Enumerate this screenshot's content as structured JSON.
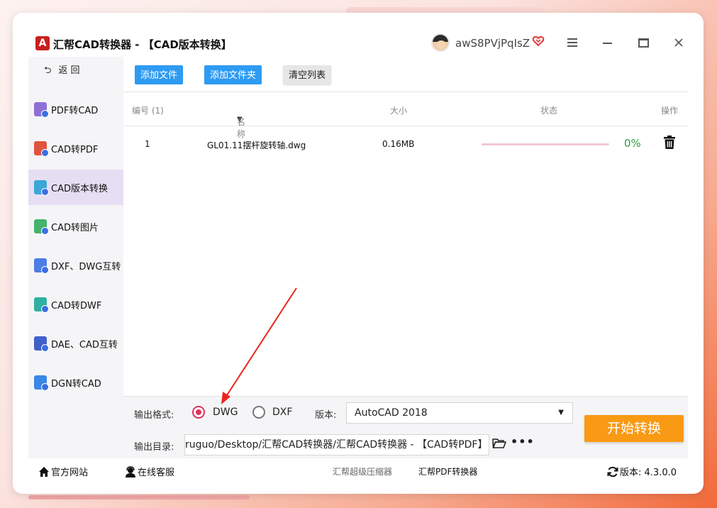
{
  "window": {
    "title": "汇帮CAD转换器 - 【CAD版本转换】",
    "logo_letter": "A",
    "username": "awS8PVjPqIsZ",
    "icons": [
      "vip-heart-icon",
      "menu-icon",
      "minimize-icon",
      "maximize-icon",
      "close-icon"
    ]
  },
  "sidebar": {
    "back_label": "返 回",
    "items": [
      {
        "label": "PDF转CAD",
        "icon": "pdf-to-cad-icon",
        "active": false
      },
      {
        "label": "CAD转PDF",
        "icon": "cad-to-pdf-icon",
        "active": false
      },
      {
        "label": "CAD版本转换",
        "icon": "cad-version-icon",
        "active": true
      },
      {
        "label": "CAD转图片",
        "icon": "cad-to-image-icon",
        "active": false
      },
      {
        "label": "DXF、DWG互转",
        "icon": "dxf-dwg-icon",
        "active": false
      },
      {
        "label": "CAD转DWF",
        "icon": "cad-to-dwf-icon",
        "active": false
      },
      {
        "label": "DAE、CAD互转",
        "icon": "dae-cad-icon",
        "active": false
      },
      {
        "label": "DGN转CAD",
        "icon": "dgn-to-cad-icon",
        "active": false
      }
    ]
  },
  "toolbar": {
    "add_file": "添加文件",
    "add_folder": "添加文件夹",
    "clear_list": "清空列表"
  },
  "table": {
    "headers": {
      "index": "编号 (1)",
      "name": "名称",
      "size": "大小",
      "status": "状态",
      "action": "操作"
    },
    "rows": [
      {
        "index": "1",
        "name": "GL01.11摆杆旋转轴.dwg",
        "size": "0.16MB",
        "progress": 0,
        "progress_text": "0%"
      }
    ]
  },
  "options": {
    "format_label": "输出格式:",
    "format_options": [
      "DWG",
      "DXF"
    ],
    "format_selected": "DWG",
    "version_label": "版本:",
    "version_value": "AutoCAD 2018",
    "dir_label": "输出目录:",
    "dir_value": "ruguo/Desktop/汇帮CAD转换器/汇帮CAD转换器 - 【CAD转PDF】",
    "start_label": "开始转换"
  },
  "statusbar": {
    "website": "官方网站",
    "support": "在线客服",
    "link1": "汇帮超级压缩器",
    "link2": "汇帮PDF转换器",
    "version_label": "版本:",
    "version": "4.3.0.0"
  },
  "colors": {
    "accent_blue": "#2e9bf2",
    "start_orange": "#f99a14",
    "active_side": "#e6def3",
    "radio_checked": "#e0325a",
    "annotation_red": "#e8251f",
    "progress_pct_green": "#2e9d3e"
  }
}
